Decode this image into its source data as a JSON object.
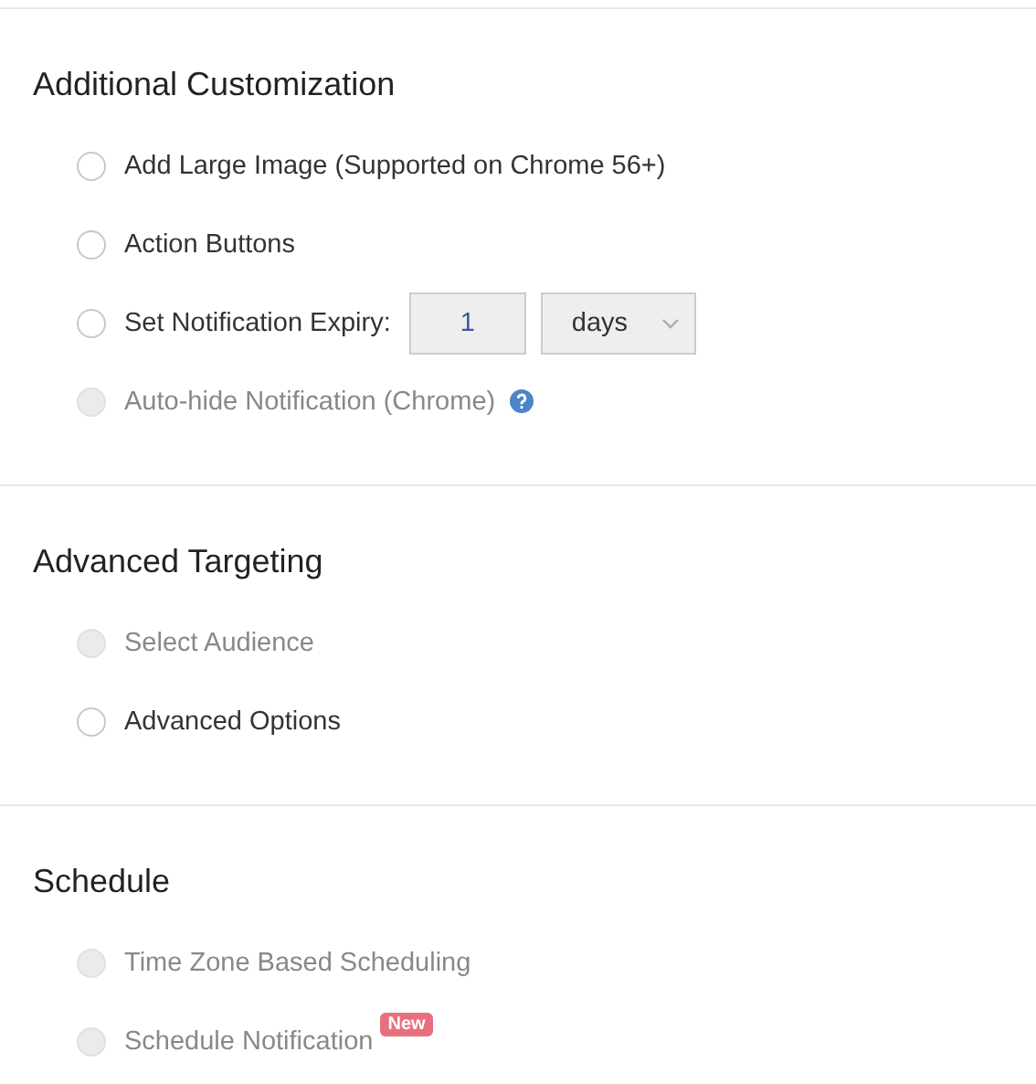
{
  "sections": [
    {
      "title": "Additional Customization",
      "options": [
        {
          "label": "Add Large Image (Supported on Chrome 56+)",
          "selected": false,
          "disabled": false
        },
        {
          "label": "Action Buttons",
          "selected": false,
          "disabled": false
        },
        {
          "label": "Set Notification Expiry:",
          "selected": false,
          "disabled": false,
          "kind": "expiry",
          "value": "1",
          "unit": "days"
        },
        {
          "label": "Auto-hide Notification (Chrome)",
          "selected": false,
          "disabled": true,
          "help": true
        }
      ]
    },
    {
      "title": "Advanced Targeting",
      "options": [
        {
          "label": "Select Audience",
          "selected": false,
          "disabled": true
        },
        {
          "label": "Advanced Options",
          "selected": false,
          "disabled": false
        }
      ]
    },
    {
      "title": "Schedule",
      "options": [
        {
          "label": "Time Zone Based Scheduling",
          "selected": false,
          "disabled": true
        },
        {
          "label": "Schedule Notification",
          "selected": false,
          "disabled": true,
          "badge": "New"
        }
      ]
    }
  ]
}
